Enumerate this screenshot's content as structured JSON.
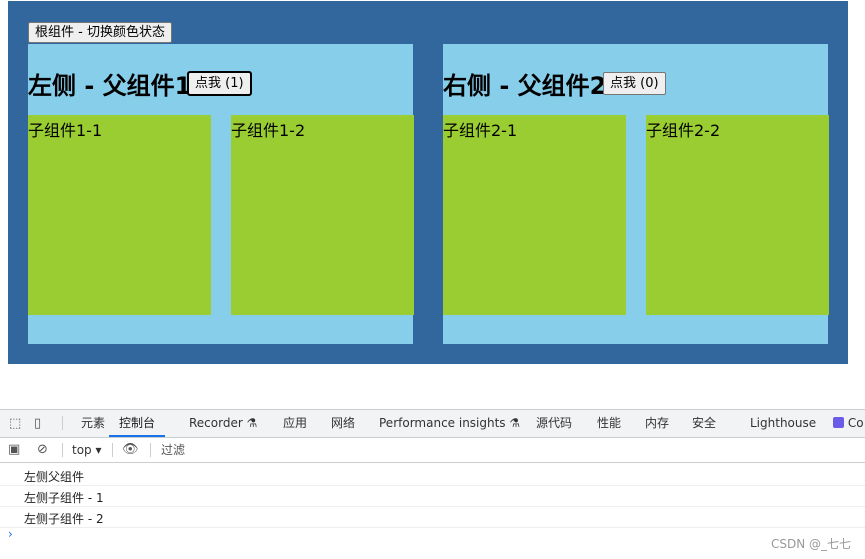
{
  "app": {
    "root_button": "根组件 - 切换颜色状态",
    "left": {
      "title": "左侧 - 父组件1",
      "button": "点我 (1)",
      "children": [
        "子组件1-1",
        "子组件1-2"
      ]
    },
    "right": {
      "title": "右侧 - 父组件2",
      "button": "点我 (0)",
      "children": [
        "子组件2-1",
        "子组件2-2"
      ]
    },
    "colors": {
      "root_bg": "#31679c",
      "parent_bg": "#87ceeb",
      "child_bg": "#9acd32"
    }
  },
  "devtools": {
    "tabs": [
      "元素",
      "控制台",
      "Recorder",
      "应用",
      "网络",
      "Performance insights",
      "源代码",
      "性能",
      "内存",
      "安全",
      "Lighthouse",
      "Co"
    ],
    "active_tab": "控制台",
    "context": "top",
    "filter_placeholder": "过滤",
    "logs": [
      "左侧父组件",
      "左侧子组件 - 1",
      "左侧子组件 - 2"
    ]
  },
  "watermark": "CSDN @_七七"
}
